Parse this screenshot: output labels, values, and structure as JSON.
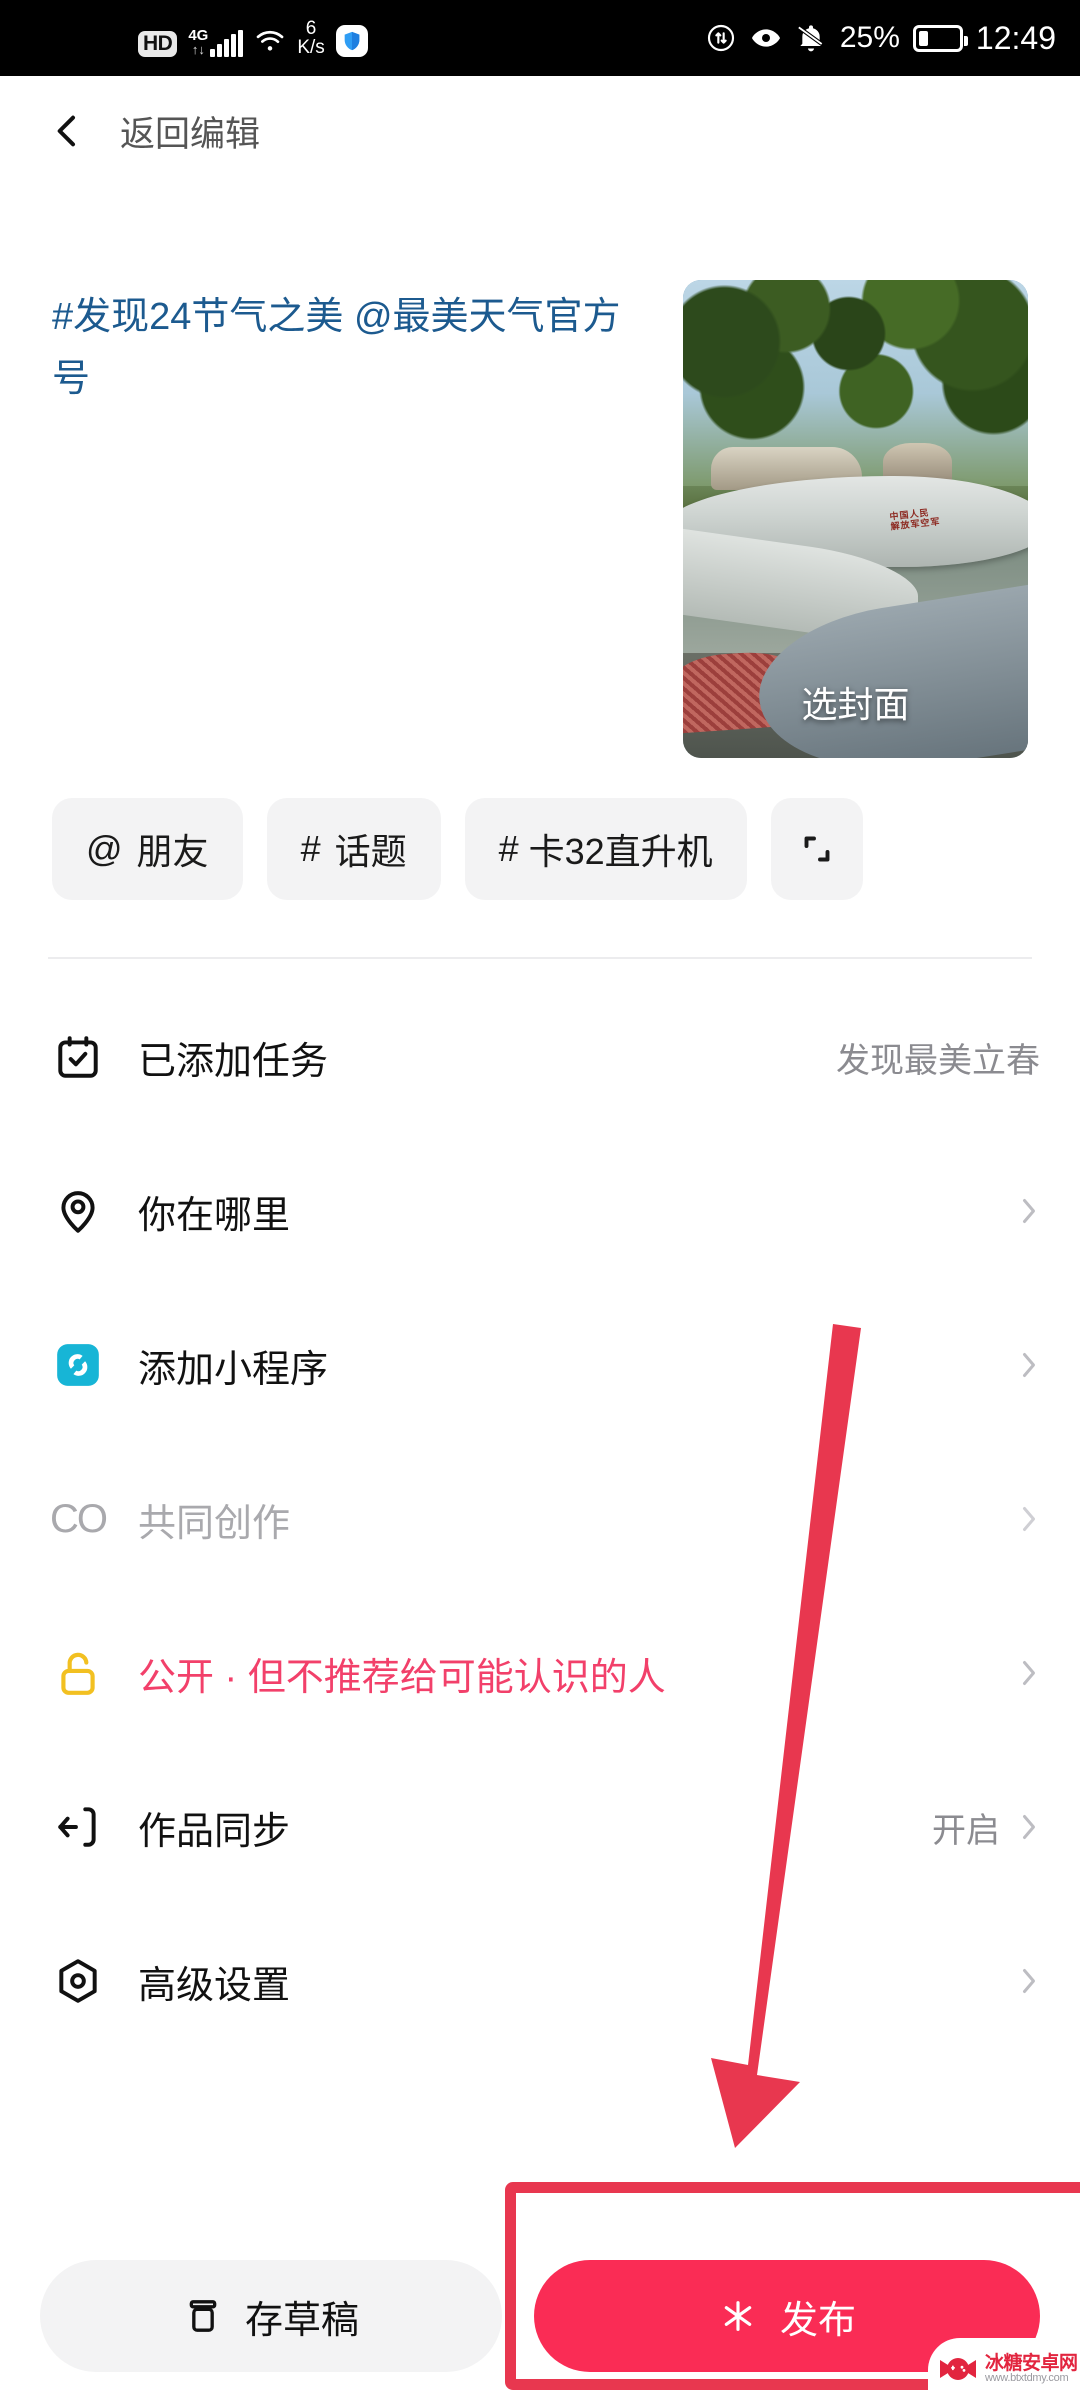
{
  "statusbar": {
    "hd_badge": "HD",
    "network_type": "4G",
    "network_sub": "↑↓",
    "data_rate_value": "6",
    "data_rate_unit": "K/s",
    "shield_icon": "shield-icon",
    "data_saver_icon": "data-saver-icon",
    "eye_comfort_icon": "eye-comfort-icon",
    "mute_icon": "bell-muted-icon",
    "battery_percent": "25%",
    "clock": "12:49"
  },
  "navbar": {
    "back_icon": "chevron-left-icon",
    "title": "返回编辑"
  },
  "compose": {
    "caption": "#发现24节气之美 @最美天气官方号",
    "caption_color": "#1c5a8f",
    "cover_label": "选封面",
    "cover_alt": "helicopter-photo"
  },
  "chips": [
    {
      "symbol": "@",
      "label": "朋友",
      "name": "chip-mention-friend"
    },
    {
      "symbol": "#",
      "label": "话题",
      "name": "chip-topic"
    },
    {
      "symbol": "#",
      "label": "卡32直升机",
      "name": "chip-tag-ka32",
      "tight": true
    },
    {
      "symbol": "",
      "label": "",
      "name": "chip-scan",
      "icon": "crop-corners-icon"
    }
  ],
  "settings": [
    {
      "name": "row-task",
      "icon": "calendar-check-icon",
      "label": "已添加任务",
      "value": "发现最美立春",
      "chevron": false,
      "state": "normal"
    },
    {
      "name": "row-location",
      "icon": "location-pin-icon",
      "label": "你在哪里",
      "value": "",
      "chevron": true,
      "state": "normal"
    },
    {
      "name": "row-miniprogram",
      "icon": "mini-program-icon",
      "label": "添加小程序",
      "value": "",
      "chevron": true,
      "state": "normal"
    },
    {
      "name": "row-cocreate",
      "icon": "co-icon",
      "label": "共同创作",
      "value": "",
      "chevron": true,
      "state": "disabled"
    },
    {
      "name": "row-privacy",
      "icon": "unlock-icon",
      "label": "公开 · 但不推荐给可能认识的人",
      "value": "",
      "chevron": true,
      "state": "danger"
    },
    {
      "name": "row-sync",
      "icon": "sync-export-icon",
      "label": "作品同步",
      "value": "开启",
      "chevron": true,
      "state": "normal"
    },
    {
      "name": "row-advanced",
      "icon": "hexagon-settings-icon",
      "label": "高级设置",
      "value": "",
      "chevron": true,
      "state": "normal"
    }
  ],
  "bottombar": {
    "draft_icon": "draft-box-icon",
    "draft_label": "存草稿",
    "publish_icon": "sparkle-icon",
    "publish_label": "发布",
    "publish_color": "#fa2c55"
  },
  "annotation": {
    "arrow_color": "#e8374f",
    "highlight_color": "#e8374f",
    "arrow_name": "red-arrow-annotation",
    "box_name": "red-highlight-box-annotation"
  },
  "watermark": {
    "site_name": "冰糖安卓网",
    "site_url": "www.btxtdmy.com"
  }
}
